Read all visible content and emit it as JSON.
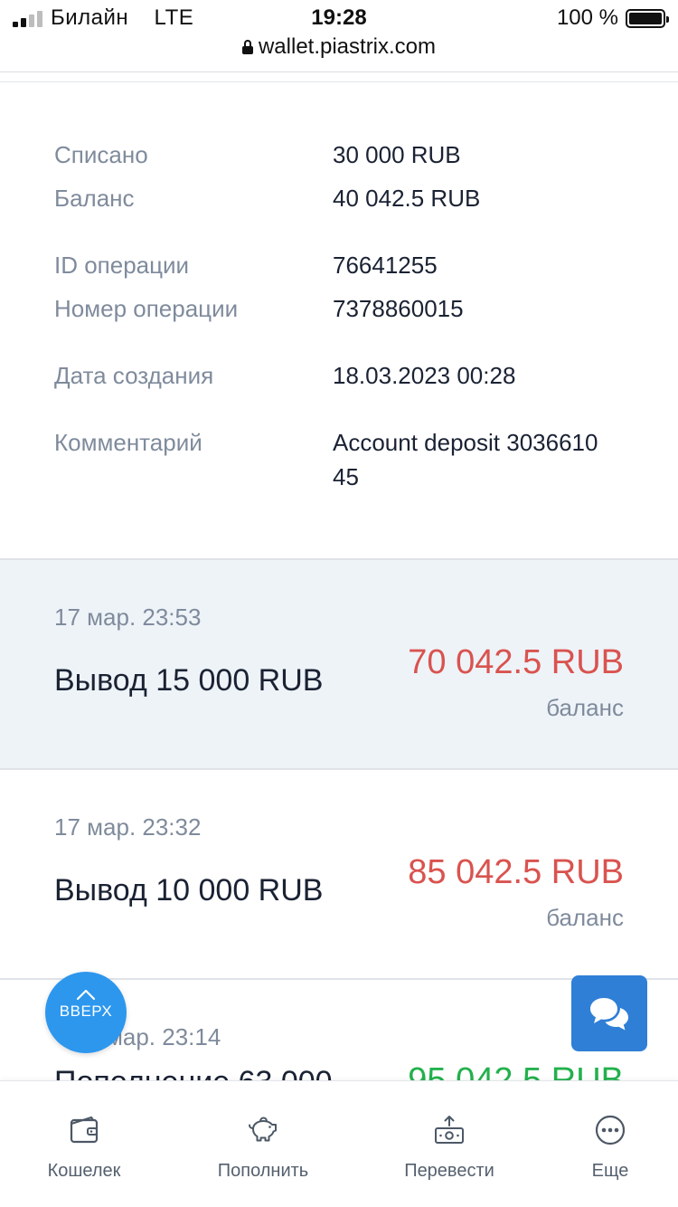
{
  "status_bar": {
    "carrier": "Билайн",
    "network": "LTE",
    "time": "19:28",
    "battery": "100 %",
    "url": "wallet.piastrix.com"
  },
  "details": [
    {
      "label": "Списано",
      "value": "30 000 RUB"
    },
    {
      "label": "Баланс",
      "value": "40 042.5 RUB"
    },
    {
      "label": "ID операции",
      "value": "76641255"
    },
    {
      "label": "Номер операции",
      "value": "7378860015"
    },
    {
      "label": "Дата создания",
      "value": "18.03.2023 00:28"
    },
    {
      "label": "Комментарий",
      "value_line1": "Account deposit 3036610",
      "value_line2": "45"
    }
  ],
  "transactions": [
    {
      "date": "17 мар.  23:53",
      "title": "Вывод 15 000 RUB",
      "amount": "70 042.5 RUB",
      "sub": "баланс",
      "amount_color": "#d9534f"
    },
    {
      "date": "17 мар.  23:32",
      "title": "Вывод 10 000 RUB",
      "amount": "85 042.5 RUB",
      "sub": "баланс",
      "amount_color": "#d9534f"
    },
    {
      "date_partial": "мар.  23:14",
      "title_partial": "Пополнение 63 000",
      "amount_partial": "95 042.5 RUB",
      "amount_color": "#23b14d"
    }
  ],
  "up_button": {
    "label": "ВВЕРХ",
    "icon": "chevron-up-icon"
  },
  "chat_button": {
    "icon": "chat-bubbles-icon"
  },
  "bottom_nav": [
    {
      "label": "Кошелек",
      "icon": "wallet-icon"
    },
    {
      "label": "Пополнить",
      "icon": "piggy-bank-icon"
    },
    {
      "label": "Перевести",
      "icon": "money-transfer-icon"
    },
    {
      "label": "Еще",
      "icon": "more-icon"
    }
  ],
  "colors": {
    "accent_blue": "#2d97ee",
    "chat_blue": "#2f7fd6",
    "negative": "#d9534f",
    "positive": "#23b14d",
    "muted_text": "#7f8b9c",
    "highlight_bg": "#eef3f8"
  }
}
